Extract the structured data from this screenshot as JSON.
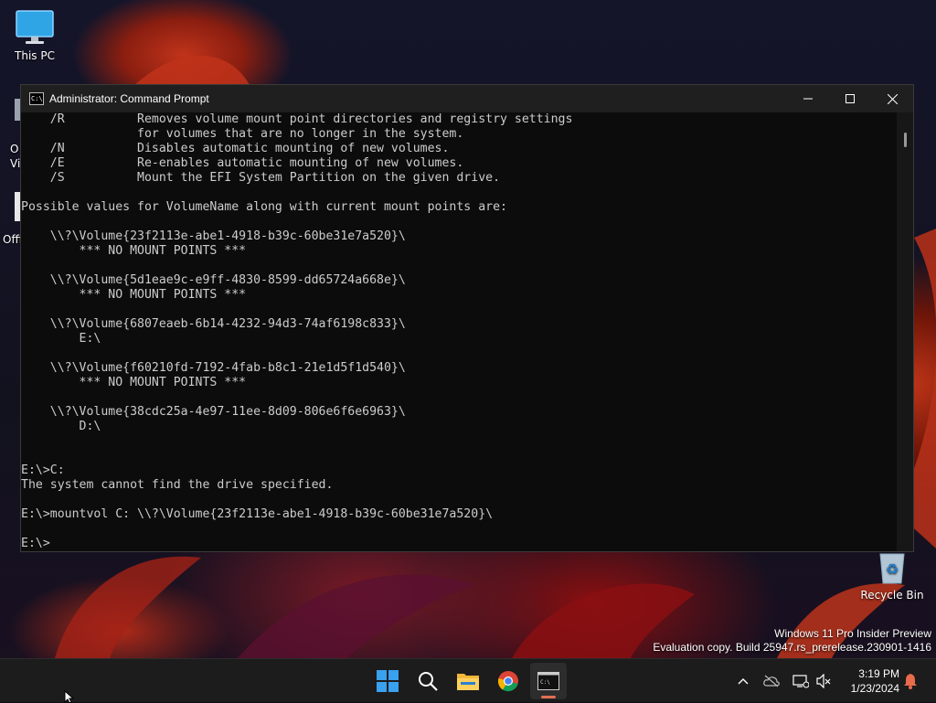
{
  "desktop": {
    "icons": [
      {
        "label": "This PC",
        "icon": "monitor-icon"
      },
      {
        "label": "Recycle Bin",
        "icon": "recycle-bin-icon"
      }
    ],
    "partial_labels": [
      "O",
      "Vi",
      "Offi"
    ],
    "watermark": {
      "line1": "Windows 11 Pro Insider Preview",
      "line2": "Evaluation copy. Build 25947.rs_prerelease.230901-1416"
    }
  },
  "window": {
    "title": "Administrator: Command Prompt",
    "icon": "cmd-app-icon",
    "controls": [
      "minimize-icon",
      "maximize-icon",
      "close-icon"
    ],
    "console_lines": [
      "    /R          Removes volume mount point directories and registry settings",
      "                for volumes that are no longer in the system.",
      "    /N          Disables automatic mounting of new volumes.",
      "    /E          Re-enables automatic mounting of new volumes.",
      "    /S          Mount the EFI System Partition on the given drive.",
      "",
      "Possible values for VolumeName along with current mount points are:",
      "",
      "    \\\\?\\Volume{23f2113e-abe1-4918-b39c-60be31e7a520}\\",
      "        *** NO MOUNT POINTS ***",
      "",
      "    \\\\?\\Volume{5d1eae9c-e9ff-4830-8599-dd65724a668e}\\",
      "        *** NO MOUNT POINTS ***",
      "",
      "    \\\\?\\Volume{6807eaeb-6b14-4232-94d3-74af6198c833}\\",
      "        E:\\",
      "",
      "    \\\\?\\Volume{f60210fd-7192-4fab-b8c1-21e1d5f1d540}\\",
      "        *** NO MOUNT POINTS ***",
      "",
      "    \\\\?\\Volume{38cdc25a-4e97-11ee-8d09-806e6f6e6963}\\",
      "        D:\\",
      "",
      "",
      "E:\\>C:",
      "The system cannot find the drive specified.",
      "",
      "E:\\>mountvol C: \\\\?\\Volume{23f2113e-abe1-4918-b39c-60be31e7a520}\\",
      "",
      "E:\\>"
    ]
  },
  "taskbar": {
    "apps": [
      {
        "name": "start",
        "icon": "windows-start-icon"
      },
      {
        "name": "search",
        "icon": "search-icon"
      },
      {
        "name": "file-explorer",
        "icon": "folder-icon"
      },
      {
        "name": "chrome",
        "icon": "chrome-icon"
      },
      {
        "name": "command-prompt",
        "icon": "terminal-icon",
        "active": true
      }
    ],
    "tray": [
      "chevron-up-icon",
      "onedrive-cloud-icon",
      "network-icon",
      "volume-muted-icon"
    ],
    "clock": {
      "time": "3:19 PM",
      "date": "1/23/2024"
    },
    "notification_icon": "bell-icon"
  },
  "colors": {
    "console_bg": "#0c0c0c",
    "console_text": "#cccccc",
    "titlebar_bg": "#1f1f1f",
    "taskbar_bg": "#1c1c1c",
    "accent": "#e06f52"
  }
}
